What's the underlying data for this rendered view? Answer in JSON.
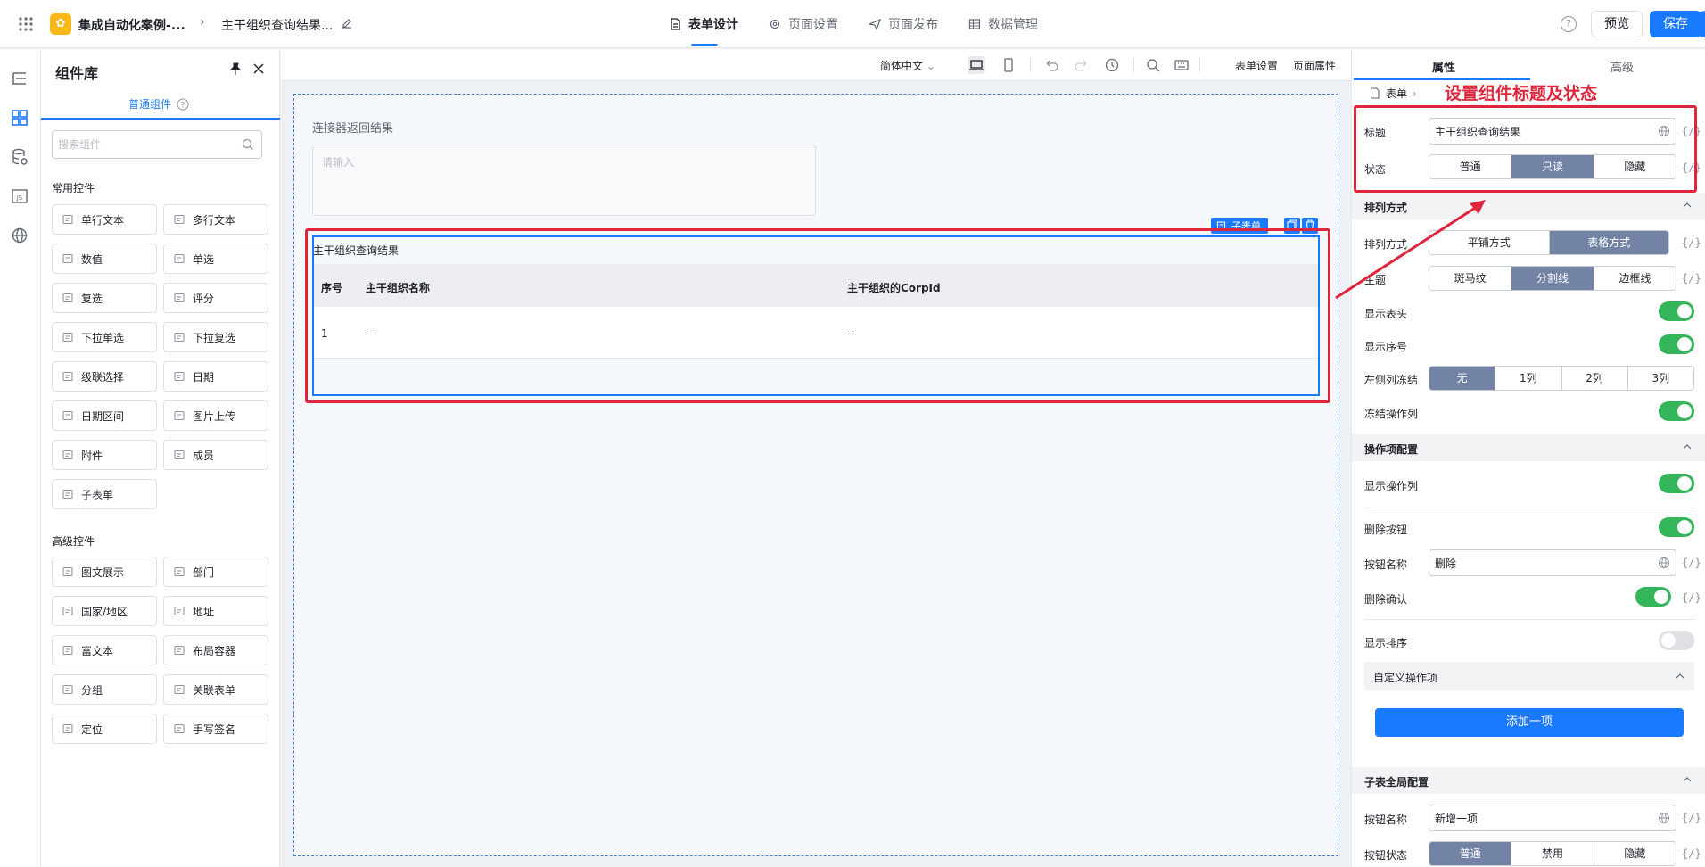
{
  "header": {
    "app_name": "集成自动化案例-...",
    "breadcrumb_sep": ">",
    "page_name": "主干组织查询结果...",
    "tabs": [
      {
        "label": "表单设计",
        "icon": "document-icon"
      },
      {
        "label": "页面设置",
        "icon": "gear-icon"
      },
      {
        "label": "页面发布",
        "icon": "send-icon"
      },
      {
        "label": "数据管理",
        "icon": "table-icon"
      }
    ],
    "help": "?",
    "preview_label": "预览",
    "save_label": "保存"
  },
  "library": {
    "title": "组件库",
    "tab_label": "普通组件",
    "search_placeholder": "搜索组件",
    "common_title": "常用控件",
    "common": [
      {
        "label": "单行文本",
        "icon": "single-line-text-icon"
      },
      {
        "label": "多行文本",
        "icon": "multi-line-text-icon"
      },
      {
        "label": "数值",
        "icon": "number-icon"
      },
      {
        "label": "单选",
        "icon": "radio-icon"
      },
      {
        "label": "复选",
        "icon": "checkbox-icon"
      },
      {
        "label": "评分",
        "icon": "star-icon"
      },
      {
        "label": "下拉单选",
        "icon": "dropdown-single-icon"
      },
      {
        "label": "下拉复选",
        "icon": "dropdown-multi-icon"
      },
      {
        "label": "级联选择",
        "icon": "cascader-icon"
      },
      {
        "label": "日期",
        "icon": "calendar-icon"
      },
      {
        "label": "日期区间",
        "icon": "date-range-icon"
      },
      {
        "label": "图片上传",
        "icon": "image-upload-icon"
      },
      {
        "label": "附件",
        "icon": "paperclip-icon"
      },
      {
        "label": "成员",
        "icon": "user-icon"
      },
      {
        "label": "子表单",
        "icon": "subform-icon"
      }
    ],
    "advanced_title": "高级控件",
    "advanced": [
      {
        "label": "图文展示",
        "icon": "rich-display-icon"
      },
      {
        "label": "部门",
        "icon": "department-icon"
      },
      {
        "label": "国家/地区",
        "icon": "globe-icon"
      },
      {
        "label": "地址",
        "icon": "map-icon"
      },
      {
        "label": "富文本",
        "icon": "rich-text-icon"
      },
      {
        "label": "布局容器",
        "icon": "layout-icon"
      },
      {
        "label": "分组",
        "icon": "group-icon"
      },
      {
        "label": "关联表单",
        "icon": "link-form-icon"
      },
      {
        "label": "定位",
        "icon": "location-icon"
      },
      {
        "label": "手写签名",
        "icon": "signature-icon"
      }
    ]
  },
  "toolbar": {
    "language": "简体中文",
    "form_settings": "表单设置",
    "page_props": "页面属性"
  },
  "canvas": {
    "field_label": "连接器返回结果",
    "field_placeholder": "请输入",
    "subform_tag": "子表单",
    "subform_title": "主干组织查询结果",
    "columns": [
      "序号",
      "主干组织名称",
      "主干组织的CorpId"
    ],
    "rows": [
      [
        "1",
        "--",
        "--"
      ]
    ]
  },
  "props": {
    "tab_props": "属性",
    "tab_advanced": "高级",
    "crumb": "表单",
    "annotation": "设置组件标题及状态",
    "fx": "{/}",
    "title_label": "标题",
    "title_value": "主干组织查询结果",
    "state_label": "状态",
    "state_options": [
      "普通",
      "只读",
      "隐藏"
    ],
    "state_selected": "只读",
    "section_layout": "排列方式",
    "layout_label": "排列方式",
    "layout_options": [
      "平铺方式",
      "表格方式"
    ],
    "theme_label": "主题",
    "theme_options": [
      "斑马纹",
      "分割线",
      "边框线"
    ],
    "show_header_label": "显示表头",
    "show_header": true,
    "show_index_label": "显示序号",
    "show_index": true,
    "freeze_left_label": "左侧列冻结",
    "freeze_options": [
      "无",
      "1列",
      "2列",
      "3列"
    ],
    "freeze_ops_label": "冻结操作列",
    "freeze_ops": true,
    "section_ops": "操作项配置",
    "show_ops_label": "显示操作列",
    "show_ops": true,
    "delete_btn_label": "删除按钮",
    "delete_btn": true,
    "btn_name_label": "按钮名称",
    "btn_name_value": "删除",
    "delete_confirm_label": "删除确认",
    "delete_confirm": true,
    "show_sort_label": "显示排序",
    "show_sort": false,
    "custom_ops": "自定义操作项",
    "add_item": "添加一项",
    "section_global": "子表全局配置",
    "global_btn_name_label": "按钮名称",
    "global_btn_name_value": "新增一项",
    "btn_state_label": "按钮状态",
    "btn_state_options": [
      "普通",
      "禁用",
      "隐藏"
    ]
  }
}
